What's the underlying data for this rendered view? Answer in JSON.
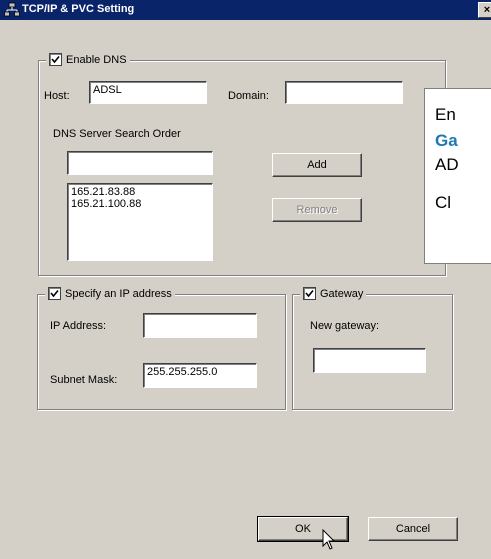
{
  "window": {
    "title": "TCP/IP & PVC Setting",
    "close_label": "×"
  },
  "dns": {
    "enable_label": "Enable DNS",
    "enabled": true,
    "host_label": "Host:",
    "host_value": "ADSL",
    "domain_label": "Domain:",
    "domain_value": "",
    "search_order_label": "DNS Server Search Order",
    "search_value": "",
    "add_label": "Add",
    "remove_label": "Remove",
    "servers": "165.21.83.88\n165.21.100.88"
  },
  "ip": {
    "specify_label": "Specify an IP address",
    "enabled": true,
    "address_label": "IP Address:",
    "address_value": "",
    "mask_label": "Subnet Mask:",
    "mask_value": "255.255.255.0"
  },
  "gateway": {
    "label": "Gateway",
    "enabled": true,
    "new_label": "New gateway:",
    "new_value": ""
  },
  "buttons": {
    "ok": "OK",
    "cancel": "Cancel"
  },
  "callout": {
    "line1": "En",
    "line2": "Ga",
    "line3": "AD",
    "line4": "Cl",
    "accent": "#1f78b4"
  }
}
